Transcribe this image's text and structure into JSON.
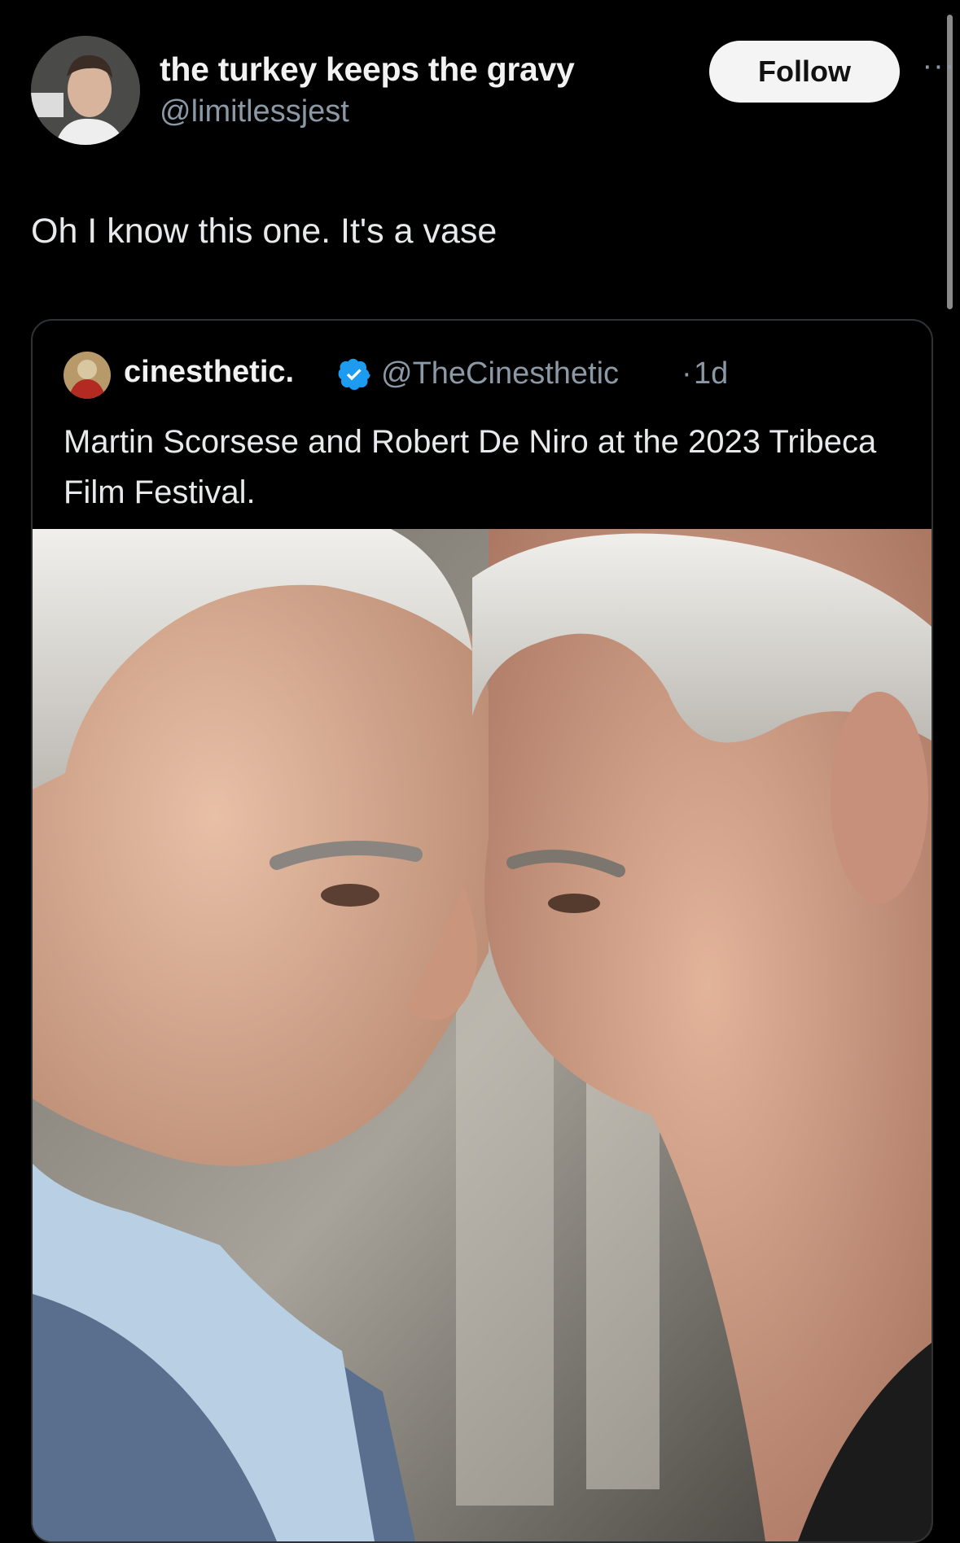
{
  "author": {
    "display_name": "the turkey keeps the gravy",
    "handle": "@limitlessjest",
    "avatar_icon": "profile-photo"
  },
  "actions": {
    "follow_label": "Follow",
    "more_label": "···"
  },
  "tweet": {
    "text": "Oh I know this one. It's a vase"
  },
  "quoted_tweet": {
    "display_name": "cinesthetic.",
    "verified_icon": "verified-badge-icon",
    "handle": "@TheCinesthetic",
    "separator": "·",
    "time": "1d",
    "text": "Martin Scorsese and Robert De Niro at the 2023 Tribeca Film Festival."
  },
  "colors": {
    "background": "#000000",
    "text_primary": "#e7e9ea",
    "text_secondary": "#8b98a5",
    "verified_blue": "#1d9bf0",
    "border": "#2f3336"
  }
}
